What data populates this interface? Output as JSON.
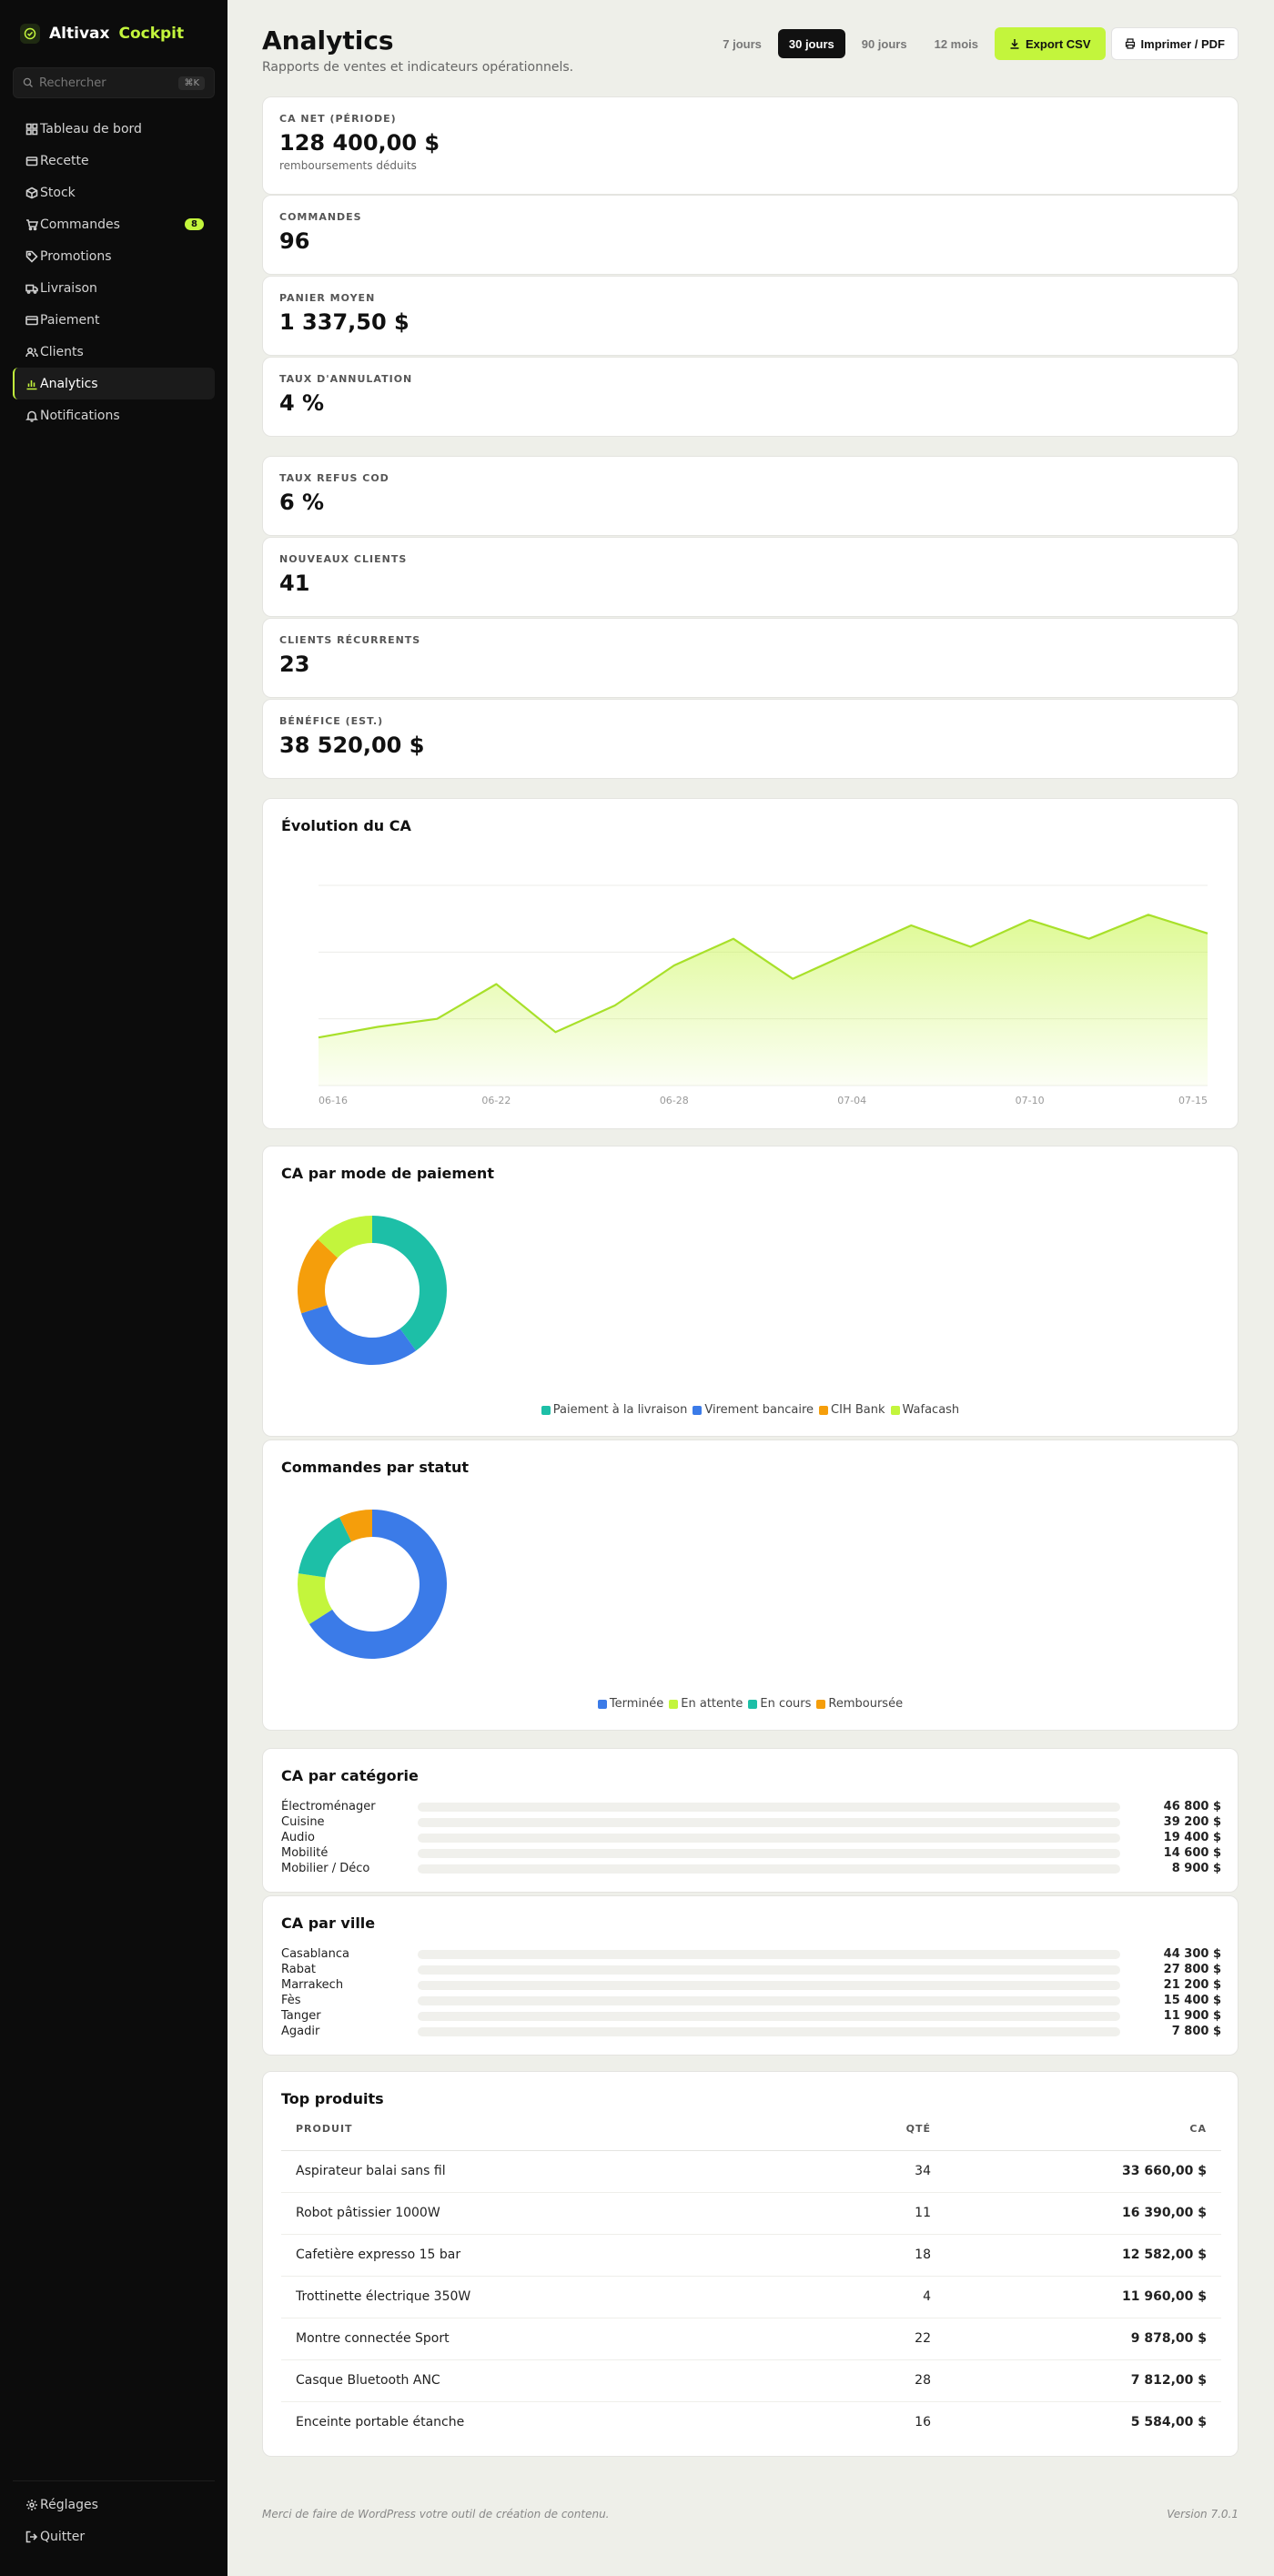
{
  "app": {
    "brand_name": "Altivax",
    "brand_accent": "Cockpit",
    "accent_color": "#c3f53c"
  },
  "sidebar": {
    "search_placeholder": "Rechercher",
    "search_shortcut": "⌘K",
    "items": [
      {
        "label": "Tableau de bord",
        "icon": "grid-icon"
      },
      {
        "label": "Recette",
        "icon": "register-icon"
      },
      {
        "label": "Stock",
        "icon": "box-icon"
      },
      {
        "label": "Commandes",
        "icon": "cart-icon",
        "badge": "8"
      },
      {
        "label": "Promotions",
        "icon": "tag-icon"
      },
      {
        "label": "Livraison",
        "icon": "truck-icon"
      },
      {
        "label": "Paiement",
        "icon": "card-icon"
      },
      {
        "label": "Clients",
        "icon": "users-icon"
      },
      {
        "label": "Analytics",
        "icon": "chart-icon",
        "active": true
      },
      {
        "label": "Notifications",
        "icon": "bell-icon"
      }
    ],
    "bottom": [
      {
        "label": "Réglages",
        "icon": "gear-icon"
      },
      {
        "label": "Quitter",
        "icon": "logout-icon"
      }
    ]
  },
  "header": {
    "title": "Analytics",
    "subtitle": "Rapports de ventes et indicateurs opérationnels.",
    "ranges": [
      "7 jours",
      "30 jours",
      "90 jours",
      "12 mois"
    ],
    "active_range": "30 jours",
    "export_label": "Export CSV",
    "print_label": "Imprimer / PDF"
  },
  "kpis": [
    {
      "label": "CA NET (PÉRIODE)",
      "value": "128 400,00 $",
      "note": "remboursements déduits"
    },
    {
      "label": "COMMANDES",
      "value": "96"
    },
    {
      "label": "PANIER MOYEN",
      "value": "1 337,50 $"
    },
    {
      "label": "TAUX D'ANNULATION",
      "value": "4 %"
    },
    {
      "label": "TAUX REFUS COD",
      "value": "6 %"
    },
    {
      "label": "NOUVEAUX CLIENTS",
      "value": "41"
    },
    {
      "label": "CLIENTS RÉCURRENTS",
      "value": "23"
    },
    {
      "label": "BÉNÉFICE (EST.)",
      "value": "38 520,00 $"
    }
  ],
  "chart_data": [
    {
      "type": "area",
      "title": "Évolution du CA",
      "x_tick_labels": [
        "06-16",
        "06-22",
        "06-28",
        "07-04",
        "07-10",
        "07-15"
      ],
      "values": [
        18,
        22,
        25,
        38,
        20,
        30,
        45,
        55,
        40,
        50,
        60,
        52,
        62,
        55,
        64,
        57
      ],
      "ylim": [
        0,
        75
      ],
      "grid": true,
      "color": "#a8e02a"
    },
    {
      "type": "pie",
      "title": "CA par mode de paiement",
      "categories": [
        "Paiement à la livraison",
        "Virement bancaire",
        "CIH Bank",
        "Wafacash"
      ],
      "values": [
        40,
        30,
        17,
        13
      ],
      "colors": [
        "#1dbfa7",
        "#3b7be8",
        "#f59e0b",
        "#c3f53c"
      ]
    },
    {
      "type": "pie",
      "title": "Commandes par statut",
      "categories": [
        "Terminée",
        "En attente",
        "En cours",
        "Remboursée"
      ],
      "values": [
        64,
        11,
        15,
        7
      ],
      "colors": [
        "#3b7be8",
        "#c3f53c",
        "#1dbfa7",
        "#f59e0b"
      ]
    }
  ],
  "categories": {
    "title": "CA par catégorie",
    "rows": [
      {
        "label": "Électroménager",
        "value": "46 800 $"
      },
      {
        "label": "Cuisine",
        "value": "39 200 $"
      },
      {
        "label": "Audio",
        "value": "19 400 $"
      },
      {
        "label": "Mobilité",
        "value": "14 600 $"
      },
      {
        "label": "Mobilier / Déco",
        "value": "8 900 $"
      }
    ]
  },
  "cities": {
    "title": "CA par ville",
    "rows": [
      {
        "label": "Casablanca",
        "value": "44 300 $"
      },
      {
        "label": "Rabat",
        "value": "27 800 $"
      },
      {
        "label": "Marrakech",
        "value": "21 200 $"
      },
      {
        "label": "Fès",
        "value": "15 400 $"
      },
      {
        "label": "Tanger",
        "value": "11 900 $"
      },
      {
        "label": "Agadir",
        "value": "7 800 $"
      }
    ]
  },
  "top_products": {
    "title": "Top produits",
    "headers": [
      "PRODUIT",
      "QTÉ",
      "CA"
    ],
    "rows": [
      {
        "name": "Aspirateur balai sans fil",
        "qty": "34",
        "ca": "33 660,00 $"
      },
      {
        "name": "Robot pâtissier 1000W",
        "qty": "11",
        "ca": "16 390,00 $"
      },
      {
        "name": "Cafetière expresso 15 bar",
        "qty": "18",
        "ca": "12 582,00 $"
      },
      {
        "name": "Trottinette électrique 350W",
        "qty": "4",
        "ca": "11 960,00 $"
      },
      {
        "name": "Montre connectée Sport",
        "qty": "22",
        "ca": "9 878,00 $"
      },
      {
        "name": "Casque Bluetooth ANC",
        "qty": "28",
        "ca": "7 812,00 $"
      },
      {
        "name": "Enceinte portable étanche",
        "qty": "16",
        "ca": "5 584,00 $"
      }
    ]
  },
  "footer": {
    "left": "Merci de faire de WordPress votre outil de création de contenu.",
    "right": "Version 7.0.1"
  }
}
